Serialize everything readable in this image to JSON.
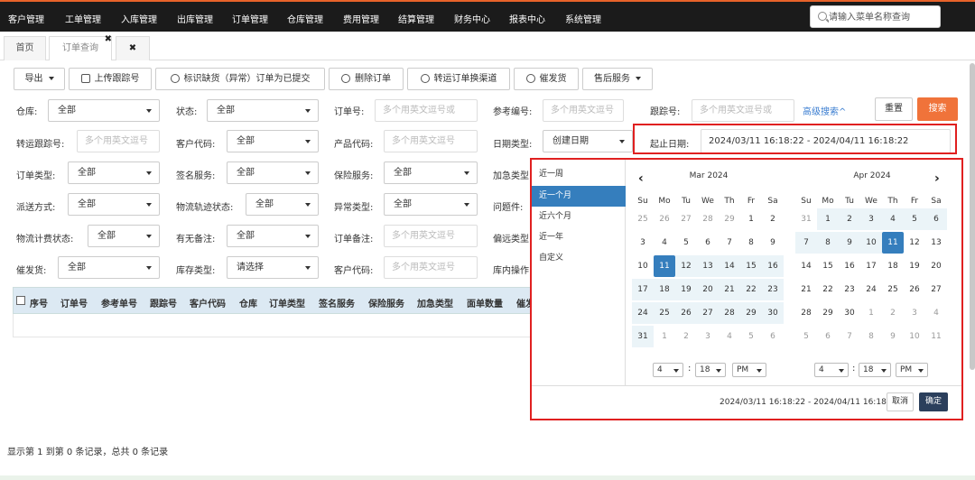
{
  "topnav": {
    "items": [
      "客户管理",
      "工单管理",
      "入库管理",
      "出库管理",
      "订单管理",
      "仓库管理",
      "费用管理",
      "结算管理",
      "财务中心",
      "报表中心",
      "系统管理"
    ],
    "search_placeholder": "请输入菜单名称查询"
  },
  "tabs": [
    {
      "label": "首页",
      "active": false
    },
    {
      "label": "订单查询",
      "active": true
    },
    {
      "label": "✖",
      "active": false
    }
  ],
  "tab_close": "✖",
  "toolbar": {
    "export": "导出",
    "upload_tracking": "上传跟踪号",
    "mark_submitted": "标识缺货（异常）订单为已提交",
    "delete_order": "删除订单",
    "transfer_channel": "转运订单换渠道",
    "urge_ship": "催发货",
    "after_sales": "售后服务"
  },
  "filters": {
    "warehouse": {
      "label": "仓库:",
      "value": "全部"
    },
    "status": {
      "label": "状态:",
      "value": "全部"
    },
    "order_no": {
      "label": "订单号:",
      "placeholder": "多个用英文逗号或"
    },
    "ref_no": {
      "label": "参考编号:",
      "placeholder": "多个用英文逗号"
    },
    "tracking_no": {
      "label": "跟踪号:",
      "placeholder": "多个用英文逗号或"
    },
    "advanced": "高级搜索^",
    "reset": "重置",
    "search": "搜索",
    "transfer_tracking": {
      "label": "转运跟踪号:",
      "placeholder": "多个用英文逗号"
    },
    "customer_code": {
      "label": "客户代码:",
      "value": "全部"
    },
    "product_code": {
      "label": "产品代码:",
      "placeholder": "多个用英文逗号"
    },
    "date_type": {
      "label": "日期类型:",
      "value": "创建日期"
    },
    "date_range": {
      "label": "起止日期:",
      "value": "2024/03/11 16:18:22 - 2024/04/11 16:18:22"
    },
    "order_type": {
      "label": "订单类型:",
      "value": "全部"
    },
    "sign_service": {
      "label": "签名服务:",
      "value": "全部"
    },
    "insurance_service": {
      "label": "保险服务:",
      "value": "全部"
    },
    "urgent_type": {
      "label": "加急类型"
    },
    "delivery_method": {
      "label": "派送方式:",
      "value": "全部"
    },
    "logistics_track_status": {
      "label": "物流轨迹状态:",
      "value": "全部"
    },
    "exception_type": {
      "label": "异常类型:",
      "value": "全部"
    },
    "problem_item": {
      "label": "问题件:"
    },
    "logistics_billing_status": {
      "label": "物流计费状态:",
      "value": "全部"
    },
    "has_remark": {
      "label": "有无备注:",
      "value": "全部"
    },
    "order_remark": {
      "label": "订单备注:",
      "placeholder": "多个用英文逗号"
    },
    "remote_type": {
      "label": "偏远类型"
    },
    "urge_ship": {
      "label": "催发货:",
      "value": "全部"
    },
    "stock_type": {
      "label": "库存类型:",
      "value": "请选择"
    },
    "customer_code2": {
      "label": "客户代码:",
      "placeholder": "多个用英文逗号"
    },
    "warehouse_op": {
      "label": "库内操作"
    }
  },
  "table": {
    "headers": [
      "序号",
      "订单号",
      "参考单号",
      "跟踪号",
      "客户代码",
      "仓库",
      "订单类型",
      "签名服务",
      "保险服务",
      "加急类型",
      "面单数量",
      "催发"
    ]
  },
  "status_text": "显示第 1 到第 0 条记录，总共 0 条记录",
  "picker": {
    "ranges": [
      "近一周",
      "近一个月",
      "近六个月",
      "近一年",
      "自定义"
    ],
    "active_range": "近一个月",
    "left": {
      "title": "Mar 2024",
      "dow": [
        "Su",
        "Mo",
        "Tu",
        "We",
        "Th",
        "Fr",
        "Sa"
      ],
      "days": [
        "25",
        "26",
        "27",
        "28",
        "29",
        "1",
        "2",
        "3",
        "4",
        "5",
        "6",
        "7",
        "8",
        "9",
        "10",
        "11",
        "12",
        "13",
        "14",
        "15",
        "16",
        "17",
        "18",
        "19",
        "20",
        "21",
        "22",
        "23",
        "24",
        "25",
        "26",
        "27",
        "28",
        "29",
        "30",
        "31",
        "1",
        "2",
        "3",
        "4",
        "5",
        "6"
      ],
      "time": {
        "hour": "4",
        "minute": "18",
        "ampm": "PM"
      }
    },
    "right": {
      "title": "Apr 2024",
      "dow": [
        "Su",
        "Mo",
        "Tu",
        "We",
        "Th",
        "Fr",
        "Sa"
      ],
      "days": [
        "31",
        "1",
        "2",
        "3",
        "4",
        "5",
        "6",
        "7",
        "8",
        "9",
        "10",
        "11",
        "12",
        "13",
        "14",
        "15",
        "16",
        "17",
        "18",
        "19",
        "20",
        "21",
        "22",
        "23",
        "24",
        "25",
        "26",
        "27",
        "28",
        "29",
        "30",
        "1",
        "2",
        "3",
        "4",
        "5",
        "6",
        "7",
        "8",
        "9",
        "10",
        "11"
      ],
      "time": {
        "hour": "4",
        "minute": "18",
        "ampm": "PM"
      }
    },
    "selected_text": "2024/03/11 16:18:22 - 2024/04/11 16:18:22",
    "cancel": "取消",
    "apply": "确定",
    "prev": "‹",
    "next": "›",
    "colon": ":"
  },
  "colors": {
    "accent": "#357ebd",
    "search_btn": "#f0733a",
    "highlight_box": "#e02020",
    "nav_bg": "#1b1b1b"
  }
}
